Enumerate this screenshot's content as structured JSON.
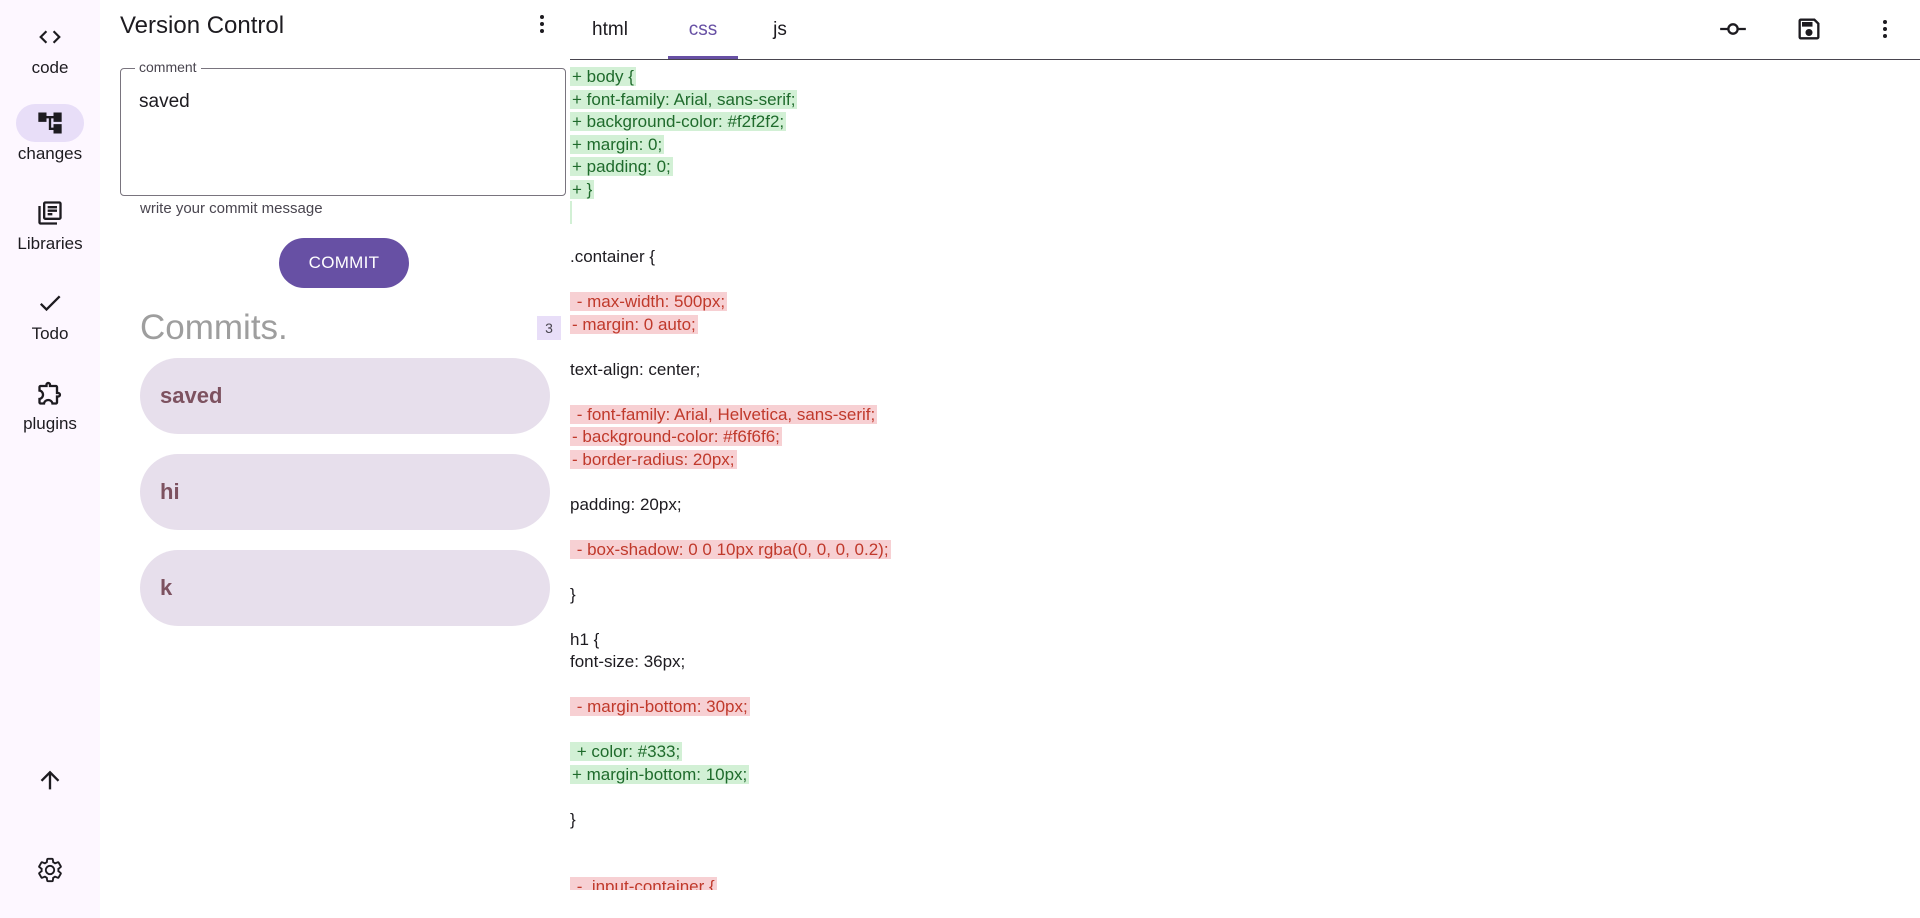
{
  "rail": {
    "items": [
      {
        "label": "code",
        "icon": "code-icon",
        "active": false
      },
      {
        "label": "changes",
        "icon": "source-tree-icon",
        "active": true
      },
      {
        "label": "Libraries",
        "icon": "library-books-icon",
        "active": false
      },
      {
        "label": "Todo",
        "icon": "check-icon",
        "active": false
      },
      {
        "label": "plugins",
        "icon": "extension-icon",
        "active": false
      }
    ],
    "bottom": [
      {
        "icon": "arrow-upward-icon"
      },
      {
        "icon": "settings-gear-icon"
      }
    ]
  },
  "panel": {
    "title": "Version Control",
    "comment_label": "comment",
    "comment_value": "saved",
    "comment_helper": "write your commit message",
    "commit_button": "COMMIT",
    "commits_heading": "Commits.",
    "commits_count": "3",
    "commits": [
      "saved",
      "hi",
      "k"
    ]
  },
  "tabs": [
    {
      "label": "html",
      "active": false
    },
    {
      "label": "css",
      "active": true
    },
    {
      "label": "js",
      "active": false
    }
  ],
  "toolbar": {
    "commit_icon": "commit-icon",
    "save_icon": "save-icon",
    "menu_icon": "more-vert-icon"
  },
  "colors": {
    "primary": "#6750a4",
    "added_bg": "#d2f0d5",
    "removed_bg": "#f7d0d3",
    "card_bg": "#e7dfec"
  },
  "diff": {
    "lines": [
      {
        "type": "add",
        "text": "+ body {"
      },
      {
        "type": "add",
        "text": "+ font-family: Arial, sans-serif;"
      },
      {
        "type": "add",
        "text": "+ background-color: #f2f2f2;"
      },
      {
        "type": "add",
        "text": "+ margin: 0;"
      },
      {
        "type": "add",
        "text": "+ padding: 0;"
      },
      {
        "type": "add",
        "text": "+ }"
      },
      {
        "type": "addgap",
        "text": ""
      },
      {
        "type": "blank",
        "text": ""
      },
      {
        "type": "ctx",
        "text": ".container {"
      },
      {
        "type": "blank",
        "text": ""
      },
      {
        "type": "del",
        "text": " - max-width: 500px;"
      },
      {
        "type": "del",
        "text": "- margin: 0 auto;"
      },
      {
        "type": "blank",
        "text": ""
      },
      {
        "type": "ctx",
        "text": "text-align: center;"
      },
      {
        "type": "blank",
        "text": ""
      },
      {
        "type": "del",
        "text": " - font-family: Arial, Helvetica, sans-serif;"
      },
      {
        "type": "del",
        "text": "- background-color: #f6f6f6;"
      },
      {
        "type": "del",
        "text": "- border-radius: 20px;"
      },
      {
        "type": "blank",
        "text": ""
      },
      {
        "type": "ctx",
        "text": "padding: 20px;"
      },
      {
        "type": "blank",
        "text": ""
      },
      {
        "type": "del",
        "text": " - box-shadow: 0 0 10px rgba(0, 0, 0, 0.2);"
      },
      {
        "type": "blank",
        "text": ""
      },
      {
        "type": "ctx",
        "text": "}"
      },
      {
        "type": "blank",
        "text": ""
      },
      {
        "type": "ctx",
        "text": "h1 {"
      },
      {
        "type": "ctx",
        "text": "font-size: 36px;"
      },
      {
        "type": "blank",
        "text": ""
      },
      {
        "type": "del",
        "text": " - margin-bottom: 30px;"
      },
      {
        "type": "blank",
        "text": ""
      },
      {
        "type": "add",
        "text": " + color: #333;"
      },
      {
        "type": "add",
        "text": "+ margin-bottom: 10px;"
      },
      {
        "type": "blank",
        "text": ""
      },
      {
        "type": "ctx",
        "text": "}"
      },
      {
        "type": "blank",
        "text": ""
      },
      {
        "type": "blank",
        "text": ""
      },
      {
        "type": "del",
        "text": " - .input-container {"
      }
    ]
  }
}
